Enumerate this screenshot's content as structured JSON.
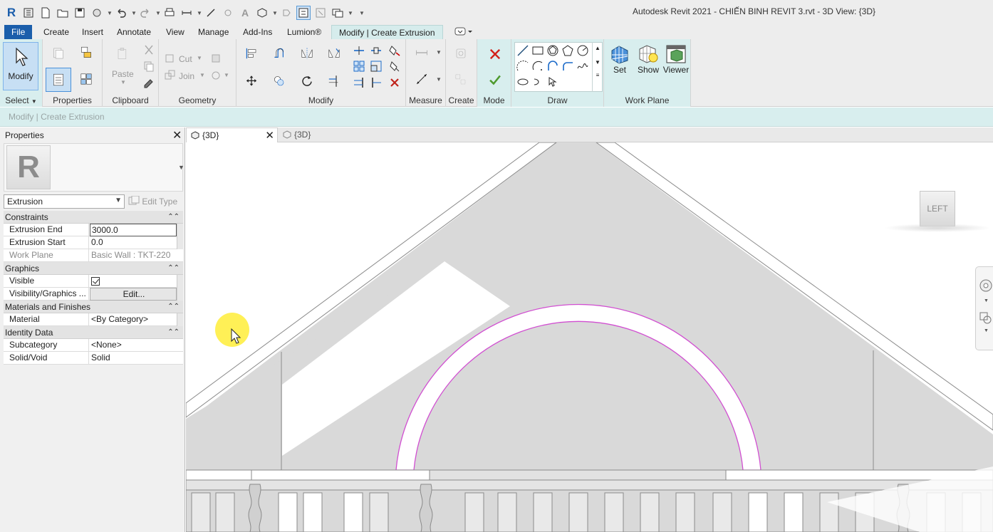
{
  "app": {
    "title": "Autodesk Revit 2021 - CHIẾN BINH REVIT 3.rvt - 3D View: {3D}"
  },
  "ribbon_tabs": [
    {
      "label": "File"
    },
    {
      "label": "Create"
    },
    {
      "label": "Insert"
    },
    {
      "label": "Annotate"
    },
    {
      "label": "View"
    },
    {
      "label": "Manage"
    },
    {
      "label": "Add-Ins"
    },
    {
      "label": "Lumion®"
    },
    {
      "label": "Modify | Create Extrusion"
    }
  ],
  "ribbon": {
    "modify_label": "Modify",
    "paste_label": "Paste",
    "cut_label": "Cut",
    "join_label": "Join",
    "set_label": "Set",
    "show_label": "Show",
    "viewer_label": "Viewer",
    "panels": {
      "select": "Select",
      "properties": "Properties",
      "clipboard": "Clipboard",
      "geometry": "Geometry",
      "modify": "Modify",
      "measure": "Measure",
      "create": "Create",
      "mode": "Mode",
      "draw": "Draw",
      "work_plane": "Work Plane"
    }
  },
  "options_bar": {
    "context": "Modify | Create Extrusion"
  },
  "properties": {
    "title": "Properties",
    "type_selector": "Extrusion",
    "edit_type_label": "Edit Type",
    "groups": {
      "constraints": "Constraints",
      "graphics": "Graphics",
      "materials": "Materials and Finishes",
      "identity": "Identity Data"
    },
    "rows": {
      "extrusion_end": {
        "label": "Extrusion End",
        "value": "3000.0"
      },
      "extrusion_start": {
        "label": "Extrusion Start",
        "value": "0.0"
      },
      "work_plane": {
        "label": "Work Plane",
        "value": "Basic Wall : TKT-220"
      },
      "visible": {
        "label": "Visible",
        "checked": true
      },
      "vis_graphics": {
        "label": "Visibility/Graphics ...",
        "value": "Edit..."
      },
      "material": {
        "label": "Material",
        "value": "<By Category>"
      },
      "subcategory": {
        "label": "Subcategory",
        "value": "<None>"
      },
      "solid_void": {
        "label": "Solid/Void",
        "value": "Solid"
      }
    }
  },
  "view_tabs": [
    {
      "label": "{3D}",
      "active": true
    },
    {
      "label": "{3D}",
      "active": false
    }
  ],
  "viewcube": {
    "face": "LEFT"
  },
  "colors": {
    "sketch_line": "#d14fd1",
    "file_tab": "#1b5eab",
    "context_tab": "#d6ecec",
    "wall_fill": "#d9d9d9"
  }
}
